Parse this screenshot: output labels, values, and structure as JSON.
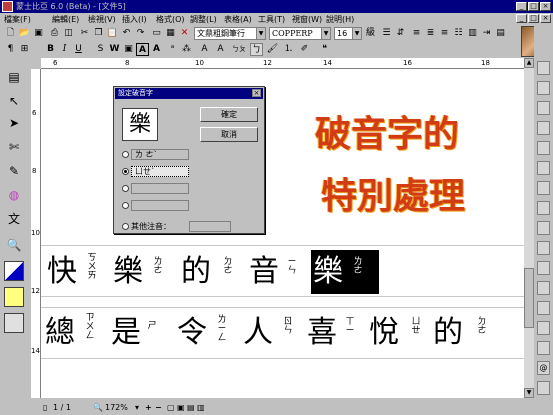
{
  "app": {
    "title": "蒙士比亞 6.0 (Beta) - [文件5]",
    "window_buttons": [
      "_",
      "□",
      "×"
    ]
  },
  "menu": [
    "檔案(F)",
    "編輯(E)",
    "檢視(V)",
    "插入(I)",
    "格式(O)",
    "調整(L)",
    "表格(A)",
    "工具(T)",
    "視窗(W)",
    "說明(H)"
  ],
  "toolbar": {
    "font_name": "文鼎粗鋼筆行",
    "latin_font": "COPPERP",
    "font_size": "16",
    "size_unit": "級"
  },
  "format_toolbar": {
    "bold": "B",
    "italic": "I",
    "underline": "U",
    "strike": "S",
    "outline": "W",
    "box_a": "A",
    "box_a2": "A",
    "zhuyin": "ㄅㄆ"
  },
  "ruler": {
    "h_ticks": [
      "6",
      "8",
      "10",
      "12",
      "14",
      "16",
      "18"
    ],
    "v_ticks": [
      "6",
      "8",
      "10",
      "12",
      "14"
    ]
  },
  "dialog": {
    "title": "設定破音字",
    "char": "樂",
    "ok": "確定",
    "cancel": "取消",
    "options": [
      "ㄌ ㄜˋ",
      "ㄩㄝˋ",
      "",
      ""
    ],
    "other_label": "其他注音："
  },
  "art_text": {
    "line1": "破音字的",
    "line2": "特別處理"
  },
  "doc_line1": [
    {
      "c": "快",
      "z": "ㄎ\nㄨ\nㄞ"
    },
    {
      "c": "樂",
      "z": "ㄌ\nㄜ"
    },
    {
      "c": "的",
      "z": "ㄉ\nㄜ"
    },
    {
      "c": "音",
      "z": "ㄧ\nㄣ"
    },
    {
      "c": "樂",
      "z": "ㄌ\nㄜ"
    }
  ],
  "doc_line2": [
    {
      "c": "總",
      "z": "ㄗ\nㄨ\nㄥ"
    },
    {
      "c": "是",
      "z": "ㄕ"
    },
    {
      "c": "令",
      "z": "ㄌ\nㄧ\nㄥ"
    },
    {
      "c": "人",
      "z": "ㄖ\nㄣ"
    },
    {
      "c": "喜",
      "z": "ㄒ\nㄧ"
    },
    {
      "c": "悅",
      "z": "ㄩ\nㄝ"
    },
    {
      "c": "的",
      "z": "ㄉ\nㄜ"
    }
  ],
  "status": {
    "page": "1 / 1",
    "zoom": "172%",
    "zoom_in": "+",
    "zoom_out": "−"
  }
}
